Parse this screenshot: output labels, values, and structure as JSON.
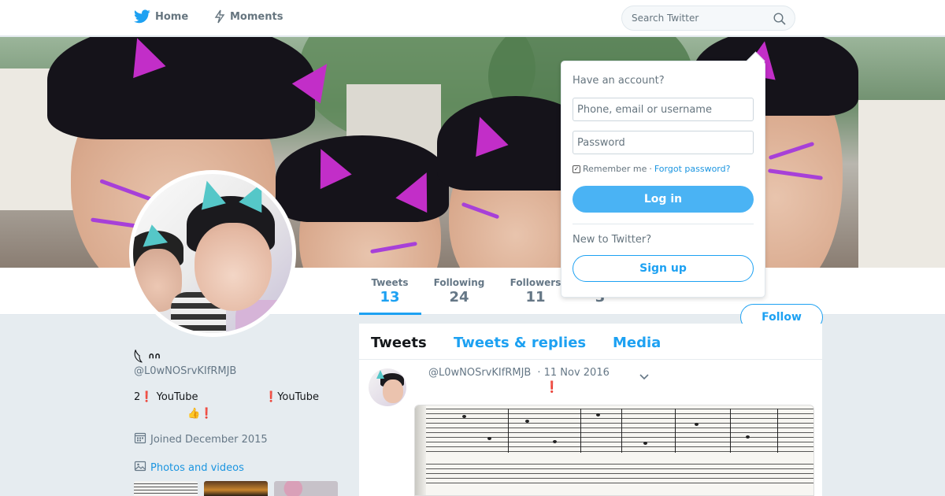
{
  "nav": {
    "home_label": "Home",
    "moments_label": "Moments",
    "search_placeholder": "Search Twitter"
  },
  "banner": {
    "login_hint": "Have an account? Log in"
  },
  "profile_nav": {
    "tweets_label": "Tweets",
    "tweets_count": "13",
    "following_label": "Following",
    "following_count": "24",
    "followers_label": "Followers",
    "followers_count": "11",
    "likes_count": "3"
  },
  "follow_label": "Follow",
  "login_popup": {
    "heading": "Have an account?",
    "username_placeholder": "Phone, email or username",
    "password_placeholder": "Password",
    "remember_label": "Remember me",
    "separator": "·",
    "forgot_label": "Forgot password?",
    "login_label": "Log in",
    "new_heading": "New to Twitter?",
    "signup_label": "Sign up"
  },
  "profile": {
    "name": "𓆩 ᐢᐢ",
    "handle": "@L0wNOSrvKIfRMJB",
    "bio_row1_a": "2",
    "bio_row1_a_ex": "❗",
    "bio_row1_a_text": "YouTube",
    "bio_row1_b_ex": "❗",
    "bio_row1_b_text": "YouTube",
    "bio_row2": "👍❗",
    "joined": "Joined December 2015",
    "photos_label": "Photos and videos"
  },
  "timeline": {
    "tabs": [
      "Tweets",
      "Tweets & replies",
      "Media"
    ],
    "tweet": {
      "handle": "@L0wNOSrvKIfRMJB",
      "date": "· 11 Nov 2016",
      "text": "❗"
    }
  },
  "colors": {
    "accent": "#1da1f2",
    "login_button": "#4ab3f4",
    "background": "#e6ecf0"
  }
}
